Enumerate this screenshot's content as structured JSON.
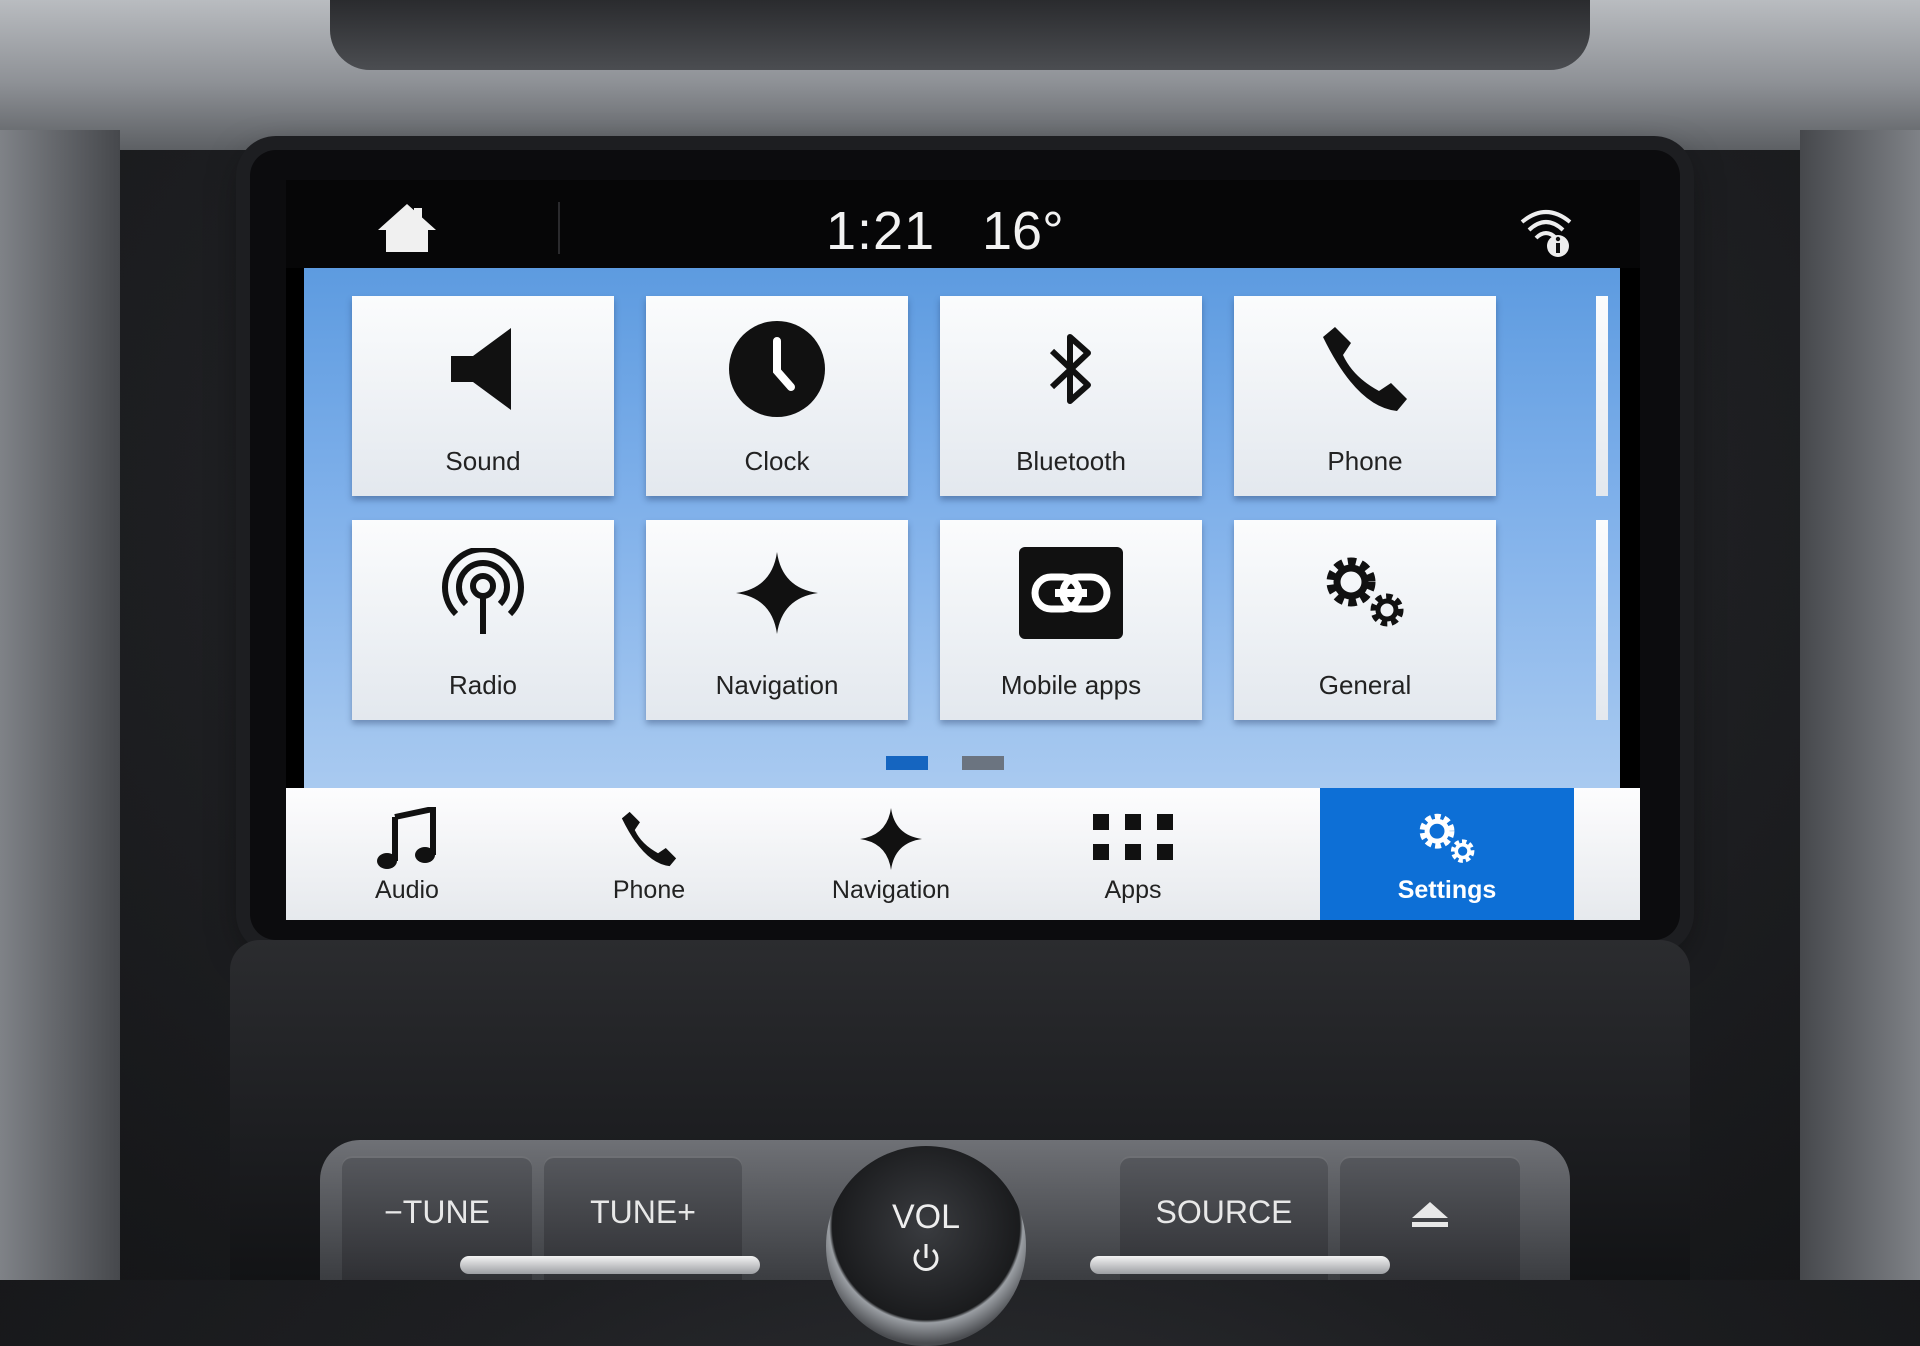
{
  "status_bar": {
    "time": "1:21",
    "temperature": "16°"
  },
  "apps_grid": {
    "tiles": [
      {
        "label": "Sound",
        "icon": "speaker-icon"
      },
      {
        "label": "Clock",
        "icon": "clock-icon"
      },
      {
        "label": "Bluetooth",
        "icon": "bluetooth-icon"
      },
      {
        "label": "Phone",
        "icon": "phone-icon"
      },
      {
        "label": "Radio",
        "icon": "radio-antenna-icon"
      },
      {
        "label": "Navigation",
        "icon": "navigation-star-icon"
      },
      {
        "label": "Mobile apps",
        "icon": "link-icon"
      },
      {
        "label": "General",
        "icon": "gears-icon"
      }
    ],
    "page_count": 2,
    "current_page": 1
  },
  "bottom_bar": {
    "items": [
      {
        "label": "Audio",
        "icon": "music-note-icon"
      },
      {
        "label": "Phone",
        "icon": "phone-icon"
      },
      {
        "label": "Navigation",
        "icon": "navigation-star-icon"
      },
      {
        "label": "Apps",
        "icon": "apps-grid-icon"
      },
      {
        "label": "Settings",
        "icon": "gears-icon"
      }
    ],
    "active_item": "Settings"
  },
  "hardware_controls": {
    "tune_down": "−TUNE",
    "tune_up": "TUNE+",
    "volume": "VOL",
    "source": "SOURCE",
    "eject_icon": "eject-icon"
  },
  "colors": {
    "accent": "#0d6fd6",
    "page_dot_active": "#1565c0",
    "page_dot_inactive": "#6b7480",
    "grid_background": "#7fb0ea"
  }
}
